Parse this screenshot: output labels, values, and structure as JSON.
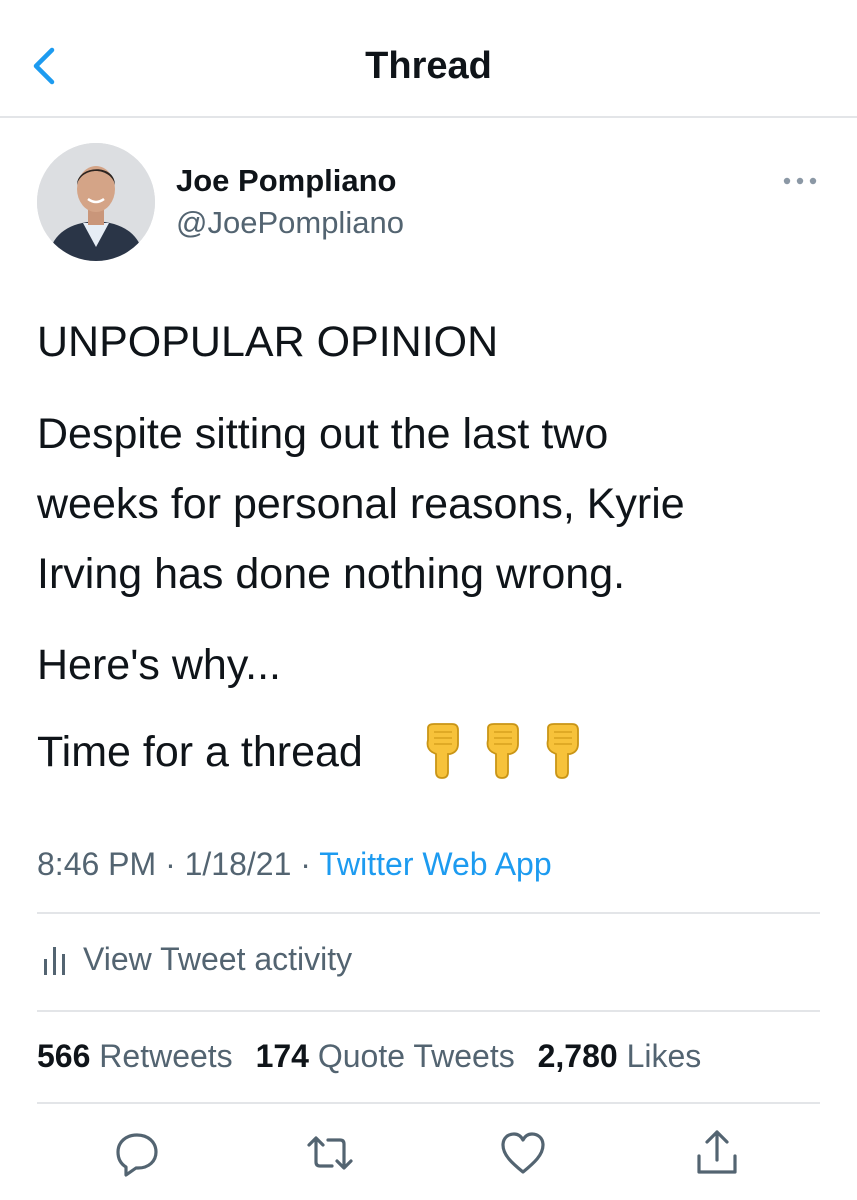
{
  "header": {
    "title": "Thread",
    "back_icon": "chevron-left-icon"
  },
  "author": {
    "name": "Joe Pompliano",
    "handle": "@JoePompliano"
  },
  "tweet": {
    "lines": [
      "UNPOPULAR OPINION",
      "Despite sitting out the last two",
      "weeks for personal reasons, Kyrie",
      "Irving has done nothing wrong.",
      "Here's why...",
      "Time for a thread"
    ],
    "emoji": [
      "pointing-down-hand",
      "pointing-down-hand",
      "pointing-down-hand"
    ]
  },
  "meta": {
    "time": "8:46 PM",
    "separator": "·",
    "date": "1/18/21",
    "source": "Twitter Web App"
  },
  "activity": {
    "label": "View Tweet activity",
    "icon": "bar-chart-icon"
  },
  "stats": {
    "retweets_count": "566",
    "retweets_label": "Retweets",
    "quotes_count": "174",
    "quotes_label": "Quote Tweets",
    "likes_count": "2,780",
    "likes_label": "Likes"
  },
  "actions": [
    "reply-icon",
    "retweet-icon",
    "like-icon",
    "share-icon"
  ],
  "colors": {
    "accent": "#1d9bf0",
    "secondary_text": "#536471",
    "primary_text": "#0f1419",
    "icon_gray": "#536471"
  }
}
